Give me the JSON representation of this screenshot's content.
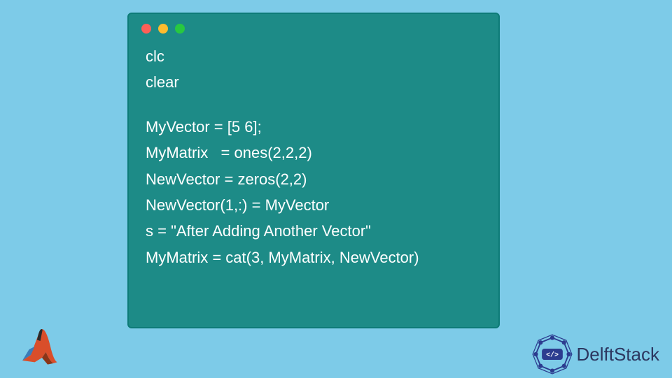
{
  "code": {
    "line1": "clc",
    "line2": "clear",
    "line3": "MyVector = [5 6];",
    "line4": "MyMatrix   = ones(2,2,2)",
    "line5": "NewVector = zeros(2,2)",
    "line6": "NewVector(1,:) = MyVector",
    "line7": "s = \"After Adding Another Vector\"",
    "line8": "MyMatrix = cat(3, MyMatrix, NewVector)"
  },
  "footer": {
    "brand": "DelftStack"
  }
}
